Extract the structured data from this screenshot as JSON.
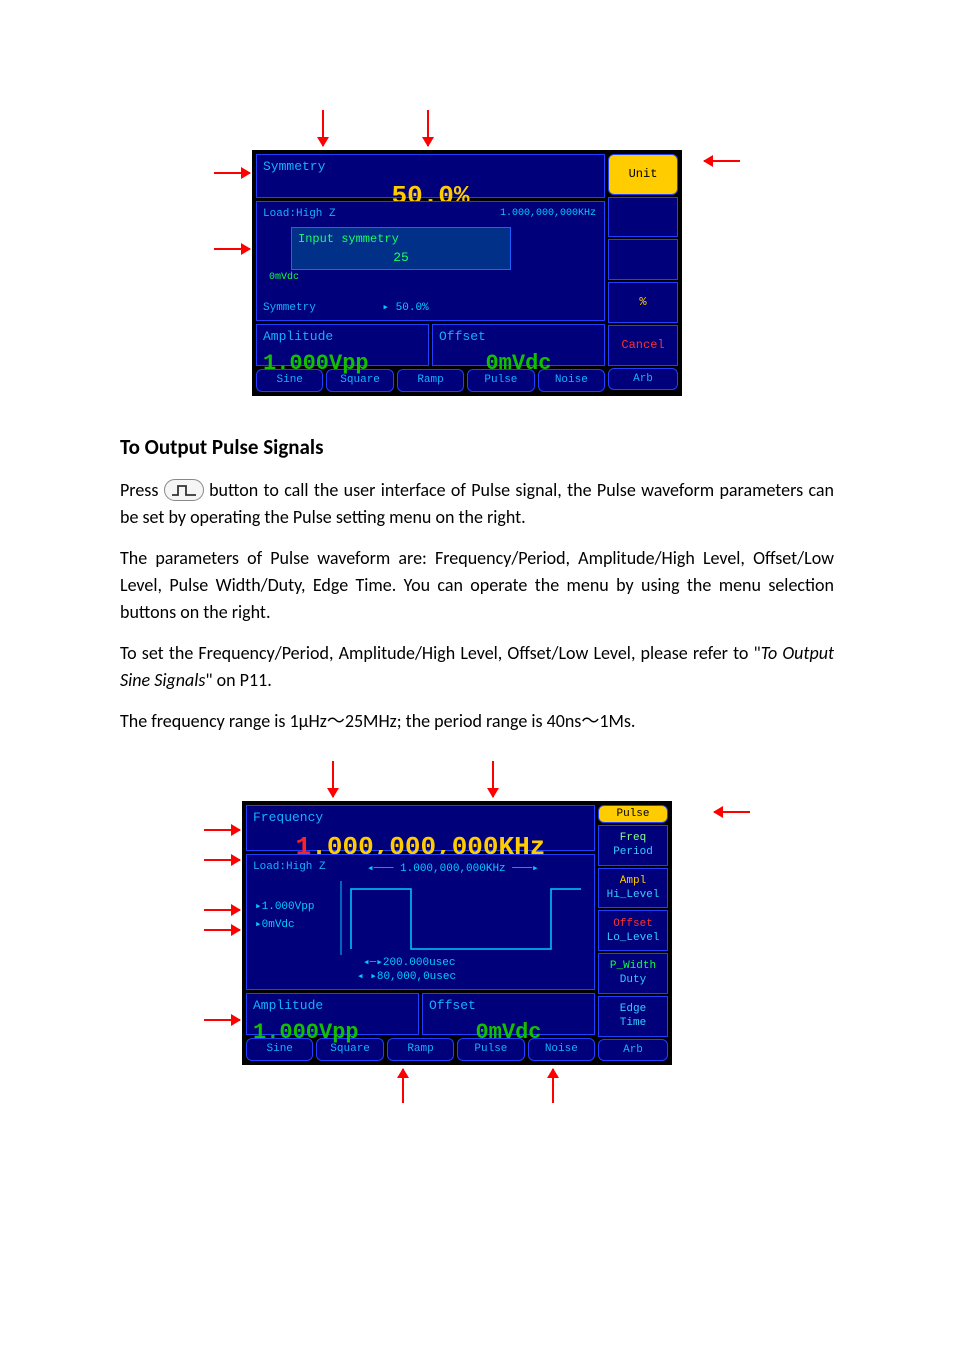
{
  "fig1": {
    "top_param_title": "Symmetry",
    "top_param_value": "50.0%",
    "load_label": "Load:High Z",
    "freq_hint": "1.000,000,000KHz",
    "input_label": "Input symmetry",
    "input_value": "25",
    "zero_line": "0mVdc",
    "symmetry_line_label": "Symmetry",
    "symmetry_line_value": "50.0%",
    "amplitude_title": "Amplitude",
    "amplitude_value": "1.000Vpp",
    "offset_title": "Offset",
    "offset_value": "0mVdc",
    "side": {
      "unit": "Unit",
      "percent": "%",
      "cancel": "Cancel",
      "arb": "Arb"
    },
    "tabs": [
      "Sine",
      "Square",
      "Ramp",
      "Pulse",
      "Noise"
    ]
  },
  "section_title": "To Output Pulse Signals",
  "body": {
    "p1a": "Press ",
    "p1b": " button to call the user interface of Pulse signal, the Pulse waveform parameters can be set by operating the Pulse setting menu on the right.",
    "p2": "The parameters of Pulse waveform are: Frequency/Period, Amplitude/High Level, Offset/Low Level, Pulse Width/Duty, Edge Time. You can operate the menu by using the menu selection buttons on the right.",
    "p3a": "To set the Frequency/Period, Amplitude/High Level, Offset/Low Level, please refer to \"",
    "p3i": "To Output Sine Signals",
    "p3b": "\" on P11.",
    "p4": "The frequency range is 1μHz～25MHz; the period range is 40ns～1Ms."
  },
  "fig2": {
    "top_param_title": "Frequency",
    "top_param_value_prefix_red": "1",
    "top_param_value_rest": ".000,000,000KHz",
    "load_label": "Load:High Z",
    "graph_freq": "1.000,000,000KHz",
    "graph_vpp": "1.000Vpp",
    "graph_dc": "0mVdc",
    "graph_w1": "200.000usec",
    "graph_w2": "80,000,0usec",
    "amplitude_title": "Amplitude",
    "amplitude_value": "1.000Vpp",
    "offset_title": "Offset",
    "offset_value": "0mVdc",
    "side": {
      "pulse": "Pulse",
      "freq": "Freq",
      "period": "Period",
      "ampl": "Ampl",
      "hi": "Hi_Level",
      "offset": "Offset",
      "lo": "Lo_Level",
      "pwidth": "P_Width",
      "duty": "Duty",
      "edge": "Edge",
      "time": "Time",
      "arb": "Arb"
    },
    "tabs": [
      "Sine",
      "Square",
      "Ramp",
      "Pulse",
      "Noise"
    ]
  }
}
